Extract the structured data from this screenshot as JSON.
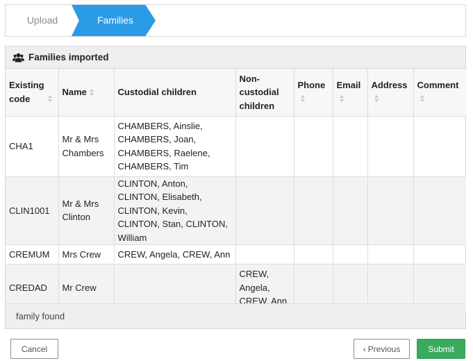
{
  "stepper": {
    "steps": [
      {
        "label": "Upload"
      },
      {
        "label": "Families"
      }
    ]
  },
  "panel": {
    "title": "Families imported",
    "icon": "users-icon",
    "columns": [
      {
        "label": "Existing code"
      },
      {
        "label": "Name"
      },
      {
        "label": "Custodial children"
      },
      {
        "label": "Non-custodial children"
      },
      {
        "label": "Phone"
      },
      {
        "label": "Email"
      },
      {
        "label": "Address"
      },
      {
        "label": "Comment"
      }
    ],
    "rows": [
      {
        "code": "CHA1",
        "name": "Mr & Mrs Chambers",
        "custodial": "CHAMBERS, Ainslie, CHAMBERS, Joan, CHAMBERS, Raelene, CHAMBERS, Tim",
        "noncustodial": "",
        "phone": "",
        "email": "",
        "address": "",
        "comment": ""
      },
      {
        "code": "CLIN1001",
        "name": "Mr & Mrs Clinton",
        "custodial": "CLINTON, Anton, CLINTON, Elisabeth, CLINTON, Kevin, CLINTON, Stan, CLINTON, William",
        "noncustodial": "",
        "phone": "",
        "email": "",
        "address": "",
        "comment": ""
      },
      {
        "code": "CREMUM",
        "name": "Mrs Crew",
        "custodial": "CREW, Angela, CREW, Ann",
        "noncustodial": "",
        "phone": "",
        "email": "",
        "address": "",
        "comment": ""
      },
      {
        "code": "CREDAD",
        "name": "Mr Crew",
        "custodial": "",
        "noncustodial": "CREW, Angela, CREW, Ann",
        "phone": "",
        "email": "",
        "address": "",
        "comment": ""
      }
    ],
    "footer": "family found"
  },
  "buttons": {
    "cancel": "Cancel",
    "previous": "Previous",
    "submit": "Submit"
  },
  "colors": {
    "active_step": "#2c9be5",
    "submit": "#3aaa5e"
  }
}
